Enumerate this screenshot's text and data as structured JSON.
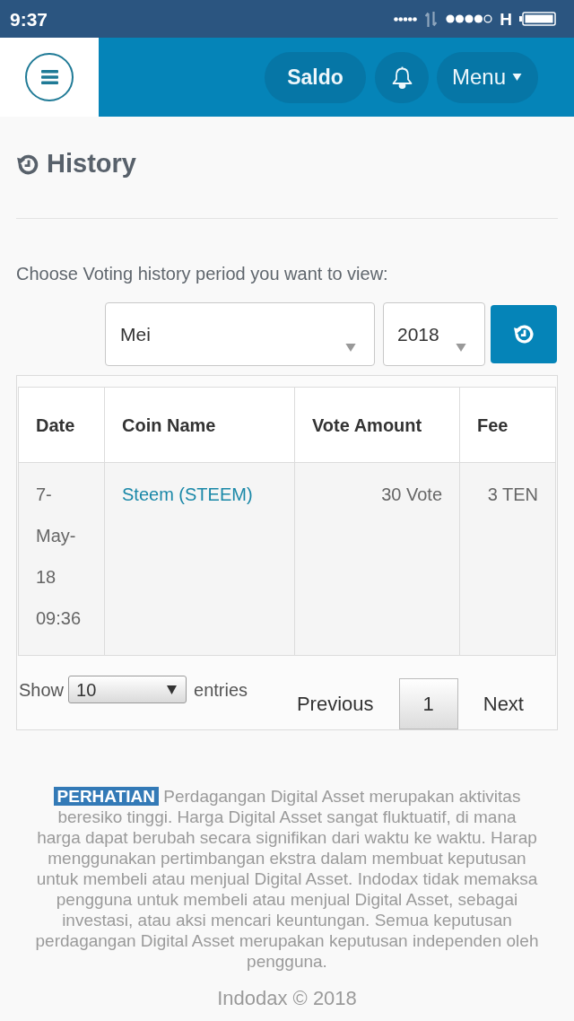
{
  "status_bar": {
    "time": "9:37",
    "network": "H"
  },
  "navbar": {
    "balance_button": "Saldo",
    "menu_button": "Menu"
  },
  "page": {
    "title": "History",
    "prompt": "Choose Voting history period you want to view:",
    "month_select": {
      "value": "Mei"
    },
    "year_select": {
      "value": "2018"
    }
  },
  "table": {
    "columns": [
      "Date",
      "Coin Name",
      "Vote Amount",
      "Fee"
    ],
    "rows": [
      {
        "date": "7-May-18 09:36",
        "coin": "Steem (STEEM)",
        "vote_amount": "30 Vote",
        "fee": "3 TEN"
      }
    ],
    "length_menu": {
      "label_before": "Show",
      "value": "10",
      "label_after": "entries"
    },
    "pagination": {
      "previous": "Previous",
      "pages": [
        {
          "label": "1",
          "selected": true
        }
      ],
      "next": "Next"
    }
  },
  "disclaimer": {
    "badge": "PERHATIAN",
    "text": "Perdagangan Digital Asset merupakan aktivitas beresiko tinggi. Harga Digital Asset sangat fluktuatif, di mana harga dapat berubah secara signifikan dari waktu ke waktu. Harap menggunakan pertimbangan ekstra dalam membuat keputusan untuk membeli atau menjual Digital Asset. Indodax tidak memaksa pengguna untuk membeli atau menjual Digital Asset, sebagai investasi, atau aksi mencari keuntungan. Semua keputusan perdagangan Digital Asset merupakan keputusan independen oleh pengguna."
  },
  "footer": {
    "copyright": "Indodax © 2018"
  }
}
